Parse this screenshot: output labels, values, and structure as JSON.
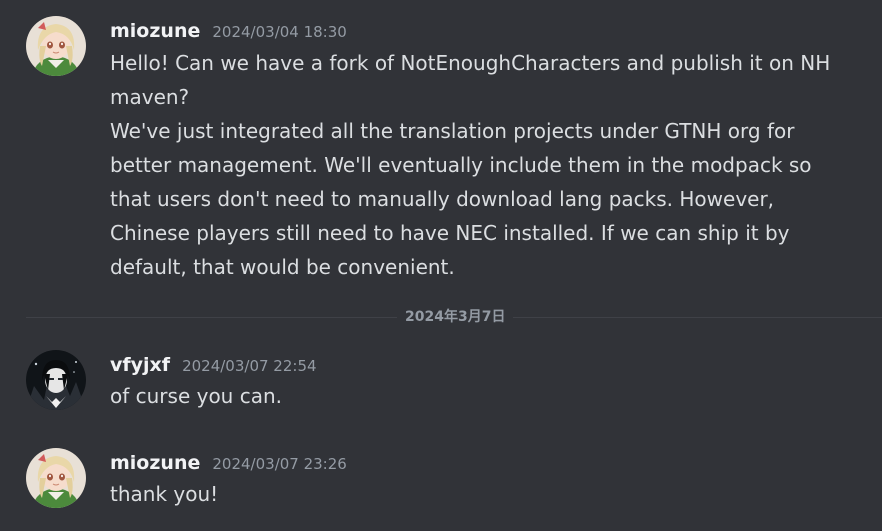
{
  "messages": [
    {
      "username": "miozune",
      "timestamp": "2024/03/04 18:30",
      "lines": [
        "Hello! Can we have a fork of NotEnoughCharacters and publish it on NH maven?",
        "We've just integrated all the translation projects under GTNH org for better management. We'll eventually include them in the modpack so that users don't need to manually download lang packs. However, Chinese players still need to have NEC installed. If we can ship it by default, that would be convenient."
      ]
    },
    {
      "username": "vfyjxf",
      "timestamp": "2024/03/07 22:54",
      "lines": [
        "of curse you can."
      ]
    },
    {
      "username": "miozune",
      "timestamp": "2024/03/07 23:26",
      "lines": [
        "thank you!"
      ]
    }
  ],
  "date_divider": "2024年3月7日",
  "colors": {
    "background": "#313338",
    "username": "#f2f3f5",
    "timestamp": "#949ba4",
    "text": "#dbdee1",
    "divider": "#3f4147"
  },
  "icons": {
    "avatar_miozune": "anime-girl-avatar",
    "avatar_vfyjxf": "dark-character-avatar"
  }
}
